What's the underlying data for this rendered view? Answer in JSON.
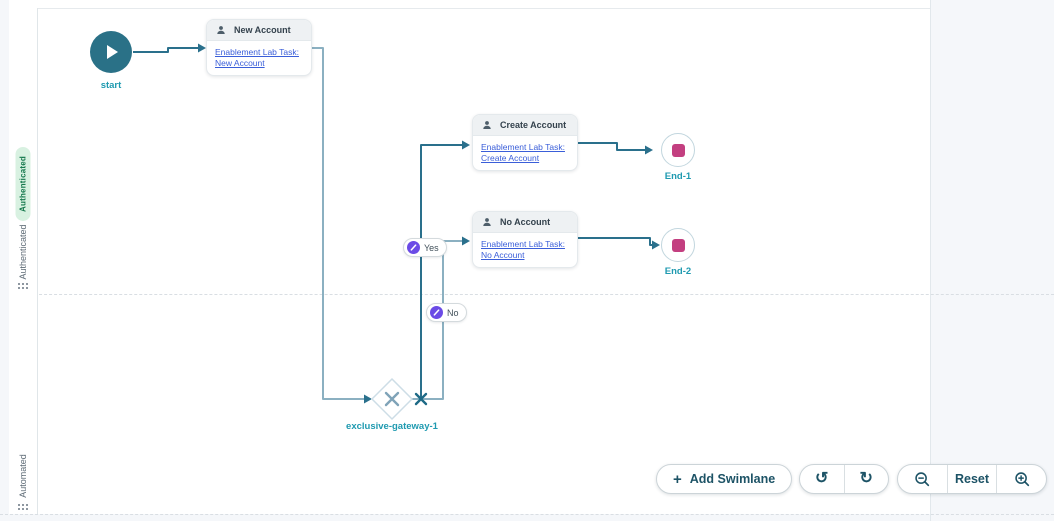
{
  "lanes": [
    {
      "badge": "Authenticated",
      "name": "Authenticated"
    },
    {
      "name": "Automated"
    }
  ],
  "nodes": {
    "start_label": "start",
    "gateway_label": "exclusive-gateway-1",
    "end1_label": "End-1",
    "end2_label": "End-2",
    "tasks": [
      {
        "title": "New Account",
        "link": "Enablement Lab Task: New Account"
      },
      {
        "title": "Create Account",
        "link": "Enablement Lab Task: Create Account"
      },
      {
        "title": "No Account",
        "link": "Enablement Lab Task: No Account"
      }
    ]
  },
  "edge_labels": {
    "yes": "Yes",
    "no": "No"
  },
  "toolbar": {
    "add_swimlane": "Add Swimlane",
    "reset": "Reset"
  },
  "icons": {
    "plus": "+",
    "undo": "↺",
    "redo": "↻"
  },
  "colors": {
    "edge_dark": "#2a708c",
    "edge_light": "#8bb0c1",
    "node_label": "#1f9ab0",
    "start_fill": "#2a7187",
    "end_fill": "#c33f80",
    "branch_badge": "#6b4be6",
    "lane_badge_bg": "#d8f1e1",
    "lane_badge_text": "#177a4e",
    "task_link": "#3a5ed9",
    "toolbar_text": "#1d5366"
  }
}
